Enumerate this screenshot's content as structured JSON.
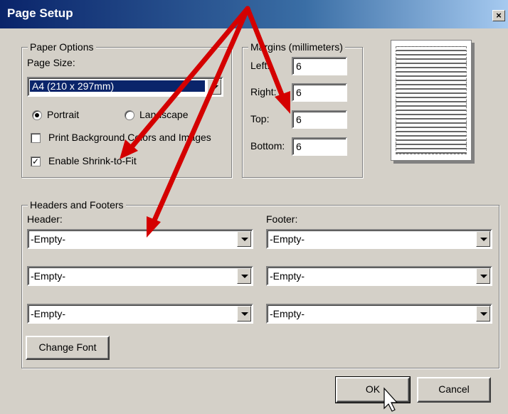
{
  "window": {
    "title": "Page Setup",
    "close_glyph": "×"
  },
  "paper_options": {
    "legend": "Paper Options",
    "page_size_label": "Page Size:",
    "page_size_value": "A4 (210 x 297mm)",
    "portrait_label": "Portrait",
    "landscape_label": "Landscape",
    "orientation_selected": "Portrait",
    "print_background_label": "Print Background Colors and Images",
    "print_background_checked": false,
    "shrink_label": "Enable Shrink-to-Fit",
    "shrink_checked": true,
    "check_glyph": "✓"
  },
  "margins": {
    "legend": "Margins (millimeters)",
    "left_label": "Left:",
    "left_value": "6",
    "right_label": "Right:",
    "right_value": "6",
    "top_label": "Top:",
    "top_value": "6",
    "bottom_label": "Bottom:",
    "bottom_value": "6"
  },
  "headers_footers": {
    "legend": "Headers and Footers",
    "header_label": "Header:",
    "footer_label": "Footer:",
    "header_values": [
      "-Empty-",
      "-Empty-",
      "-Empty-"
    ],
    "footer_values": [
      "-Empty-",
      "-Empty-",
      "-Empty-"
    ],
    "change_font_label": "Change Font"
  },
  "buttons": {
    "ok_label": "OK",
    "cancel_label": "Cancel"
  },
  "colors": {
    "arrow": "#d40000",
    "title_bar": "#0a246a"
  },
  "icons": {
    "arrows": "red-annotation-arrow-icon",
    "cursor": "mouse-pointer-icon"
  }
}
